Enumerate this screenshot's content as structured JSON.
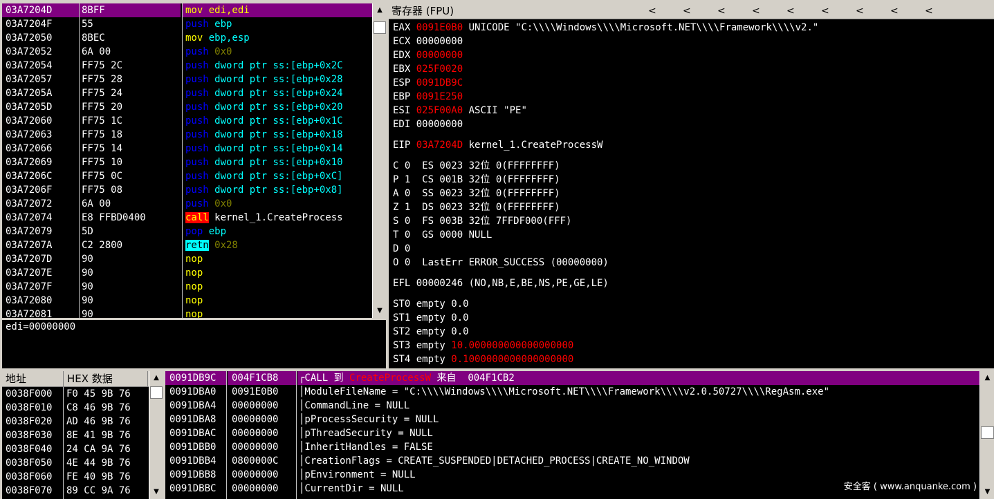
{
  "disasm": {
    "rows": [
      {
        "addr": "03A7204D",
        "hex": "8BFF",
        "parts": [
          {
            "t": "mov ",
            "c": "#ffff00"
          },
          {
            "t": "edi,edi",
            "c": "#ffff00"
          }
        ],
        "selected": true
      },
      {
        "addr": "03A7204F",
        "hex": "55",
        "parts": [
          {
            "t": "push ",
            "c": "#0000ff"
          },
          {
            "t": "ebp",
            "c": "#00ffff"
          }
        ]
      },
      {
        "addr": "03A72050",
        "hex": "8BEC",
        "parts": [
          {
            "t": "mov ",
            "c": "#ffff00"
          },
          {
            "t": "ebp,esp",
            "c": "#00ffff"
          }
        ]
      },
      {
        "addr": "03A72052",
        "hex": "6A 00",
        "parts": [
          {
            "t": "push ",
            "c": "#0000ff"
          },
          {
            "t": "0x0",
            "c": "#808000"
          }
        ]
      },
      {
        "addr": "03A72054",
        "hex": "FF75 2C",
        "parts": [
          {
            "t": "push ",
            "c": "#0000ff"
          },
          {
            "t": "dword ptr ss:[ebp+0x2C",
            "c": "#00ffff"
          }
        ]
      },
      {
        "addr": "03A72057",
        "hex": "FF75 28",
        "parts": [
          {
            "t": "push ",
            "c": "#0000ff"
          },
          {
            "t": "dword ptr ss:[ebp+0x28",
            "c": "#00ffff"
          }
        ]
      },
      {
        "addr": "03A7205A",
        "hex": "FF75 24",
        "parts": [
          {
            "t": "push ",
            "c": "#0000ff"
          },
          {
            "t": "dword ptr ss:[ebp+0x24",
            "c": "#00ffff"
          }
        ]
      },
      {
        "addr": "03A7205D",
        "hex": "FF75 20",
        "parts": [
          {
            "t": "push ",
            "c": "#0000ff"
          },
          {
            "t": "dword ptr ss:[ebp+0x20",
            "c": "#00ffff"
          }
        ]
      },
      {
        "addr": "03A72060",
        "hex": "FF75 1C",
        "parts": [
          {
            "t": "push ",
            "c": "#0000ff"
          },
          {
            "t": "dword ptr ss:[ebp+0x1C",
            "c": "#00ffff"
          }
        ]
      },
      {
        "addr": "03A72063",
        "hex": "FF75 18",
        "parts": [
          {
            "t": "push ",
            "c": "#0000ff"
          },
          {
            "t": "dword ptr ss:[ebp+0x18",
            "c": "#00ffff"
          }
        ]
      },
      {
        "addr": "03A72066",
        "hex": "FF75 14",
        "parts": [
          {
            "t": "push ",
            "c": "#0000ff"
          },
          {
            "t": "dword ptr ss:[ebp+0x14",
            "c": "#00ffff"
          }
        ]
      },
      {
        "addr": "03A72069",
        "hex": "FF75 10",
        "parts": [
          {
            "t": "push ",
            "c": "#0000ff"
          },
          {
            "t": "dword ptr ss:[ebp+0x10",
            "c": "#00ffff"
          }
        ]
      },
      {
        "addr": "03A7206C",
        "hex": "FF75 0C",
        "parts": [
          {
            "t": "push ",
            "c": "#0000ff"
          },
          {
            "t": "dword ptr ss:[ebp+0xC]",
            "c": "#00ffff"
          }
        ]
      },
      {
        "addr": "03A7206F",
        "hex": "FF75 08",
        "parts": [
          {
            "t": "push ",
            "c": "#0000ff"
          },
          {
            "t": "dword ptr ss:[ebp+0x8]",
            "c": "#00ffff"
          }
        ]
      },
      {
        "addr": "03A72072",
        "hex": "6A 00",
        "parts": [
          {
            "t": "push ",
            "c": "#0000ff"
          },
          {
            "t": "0x0",
            "c": "#808000"
          }
        ]
      },
      {
        "addr": "03A72074",
        "hex": "E8 FFBD0400",
        "parts": [
          {
            "t": "call",
            "c": "#ffff00",
            "bg": "#ff0000"
          },
          {
            "t": " kernel_1.CreateProcess",
            "c": "#ffffff"
          }
        ]
      },
      {
        "addr": "03A72079",
        "hex": "5D",
        "parts": [
          {
            "t": "pop ",
            "c": "#0000ff"
          },
          {
            "t": "ebp",
            "c": "#00ffff"
          }
        ]
      },
      {
        "addr": "03A7207A",
        "hex": "C2 2800",
        "parts": [
          {
            "t": "retn",
            "c": "#000000",
            "bg": "#00ffff"
          },
          {
            "t": " 0x28",
            "c": "#808000"
          }
        ]
      },
      {
        "addr": "03A7207D",
        "hex": "90",
        "parts": [
          {
            "t": "nop",
            "c": "#ffff00"
          }
        ]
      },
      {
        "addr": "03A7207E",
        "hex": "90",
        "parts": [
          {
            "t": "nop",
            "c": "#ffff00"
          }
        ]
      },
      {
        "addr": "03A7207F",
        "hex": "90",
        "parts": [
          {
            "t": "nop",
            "c": "#ffff00"
          }
        ]
      },
      {
        "addr": "03A72080",
        "hex": "90",
        "parts": [
          {
            "t": "nop",
            "c": "#ffff00"
          }
        ]
      },
      {
        "addr": "03A72081",
        "hex": "90",
        "parts": [
          {
            "t": "nop",
            "c": "#ffff00"
          }
        ]
      }
    ]
  },
  "info": {
    "text": "edi=00000000"
  },
  "registers": {
    "title": "寄存器 (FPU)",
    "arrows": [
      "<",
      "<",
      "<",
      "<",
      "<",
      "<",
      "<",
      "<",
      "<"
    ],
    "lines": [
      {
        "parts": [
          {
            "t": "EAX ",
            "c": "#ffffff"
          },
          {
            "t": "0091E0B0",
            "c": "#ff0000"
          },
          {
            "t": " UNICODE \"C:\\\\\\\\Windows\\\\\\\\Microsoft.NET\\\\\\\\Framework\\\\\\\\v2.\"",
            "c": "#ffffff"
          }
        ]
      },
      {
        "parts": [
          {
            "t": "ECX ",
            "c": "#ffffff"
          },
          {
            "t": "00000000",
            "c": "#ffffff"
          }
        ]
      },
      {
        "parts": [
          {
            "t": "EDX ",
            "c": "#ffffff"
          },
          {
            "t": "00000000",
            "c": "#ff0000"
          }
        ]
      },
      {
        "parts": [
          {
            "t": "EBX ",
            "c": "#ffffff"
          },
          {
            "t": "025F0020",
            "c": "#ff0000"
          }
        ]
      },
      {
        "parts": [
          {
            "t": "ESP ",
            "c": "#ffffff"
          },
          {
            "t": "0091DB9C",
            "c": "#ff0000"
          }
        ]
      },
      {
        "parts": [
          {
            "t": "EBP ",
            "c": "#ffffff"
          },
          {
            "t": "0091E250",
            "c": "#ff0000"
          }
        ]
      },
      {
        "parts": [
          {
            "t": "ESI ",
            "c": "#ffffff"
          },
          {
            "t": "025F00A0",
            "c": "#ff0000"
          },
          {
            "t": " ASCII \"PE\"",
            "c": "#ffffff"
          }
        ]
      },
      {
        "parts": [
          {
            "t": "EDI ",
            "c": "#ffffff"
          },
          {
            "t": "00000000",
            "c": "#ffffff"
          }
        ]
      },
      {
        "gap": true
      },
      {
        "parts": [
          {
            "t": "EIP ",
            "c": "#ffffff"
          },
          {
            "t": "03A7204D",
            "c": "#ff0000"
          },
          {
            "t": " kernel_1.CreateProcessW",
            "c": "#ffffff"
          }
        ]
      },
      {
        "gap": true
      },
      {
        "parts": [
          {
            "t": "C 0  ES 0023 32位 0(FFFFFFFF)",
            "c": "#ffffff"
          }
        ]
      },
      {
        "parts": [
          {
            "t": "P 1  CS 001B 32位 0(FFFFFFFF)",
            "c": "#ffffff"
          }
        ]
      },
      {
        "parts": [
          {
            "t": "A 0  SS 0023 32位 0(FFFFFFFF)",
            "c": "#ffffff"
          }
        ]
      },
      {
        "parts": [
          {
            "t": "Z 1  DS 0023 32位 0(FFFFFFFF)",
            "c": "#ffffff"
          }
        ]
      },
      {
        "parts": [
          {
            "t": "S 0  FS 003B 32位 7FFDF000(FFF)",
            "c": "#ffffff"
          }
        ]
      },
      {
        "parts": [
          {
            "t": "T 0  GS 0000 NULL",
            "c": "#ffffff"
          }
        ]
      },
      {
        "parts": [
          {
            "t": "D 0",
            "c": "#ffffff"
          }
        ]
      },
      {
        "parts": [
          {
            "t": "O 0  LastErr ERROR_SUCCESS (00000000)",
            "c": "#ffffff"
          }
        ]
      },
      {
        "gap": true
      },
      {
        "parts": [
          {
            "t": "EFL 00000246 (NO,NB,E,BE,NS,PE,GE,LE)",
            "c": "#ffffff"
          }
        ]
      },
      {
        "gap": true
      },
      {
        "parts": [
          {
            "t": "ST0 empty 0.0",
            "c": "#ffffff"
          }
        ]
      },
      {
        "parts": [
          {
            "t": "ST1 empty 0.0",
            "c": "#ffffff"
          }
        ]
      },
      {
        "parts": [
          {
            "t": "ST2 empty 0.0",
            "c": "#ffffff"
          }
        ]
      },
      {
        "parts": [
          {
            "t": "ST3 empty ",
            "c": "#ffffff"
          },
          {
            "t": "10.000000000000000000",
            "c": "#ff0000"
          }
        ]
      },
      {
        "parts": [
          {
            "t": "ST4 empty ",
            "c": "#ffffff"
          },
          {
            "t": "0.1000000000000000000",
            "c": "#ff0000"
          }
        ]
      }
    ]
  },
  "dump": {
    "headers": [
      "地址",
      "HEX 数据"
    ],
    "rows": [
      {
        "addr": "0038F000",
        "hex": "F0 45 9B 76"
      },
      {
        "addr": "0038F010",
        "hex": "C8 46 9B 76"
      },
      {
        "addr": "0038F020",
        "hex": "AD 46 9B 76"
      },
      {
        "addr": "0038F030",
        "hex": "8E 41 9B 76"
      },
      {
        "addr": "0038F040",
        "hex": "24 CA 9A 76"
      },
      {
        "addr": "0038F050",
        "hex": "4E 44 9B 76"
      },
      {
        "addr": "0038F060",
        "hex": "FE 40 9B 76"
      },
      {
        "addr": "0038F070",
        "hex": "89 CC 9A 76"
      }
    ]
  },
  "stack": {
    "rows": [
      {
        "addr": "0091DB9C",
        "val": "004F1CB8",
        "parts": [
          {
            "t": "┌CALL 到 ",
            "c": "#ffffff"
          },
          {
            "t": "CreateProcessW",
            "c": "#ff0000"
          },
          {
            "t": " 来自  004F1CB2",
            "c": "#ffffff"
          }
        ],
        "selected": true
      },
      {
        "addr": "0091DBA0",
        "val": "0091E0B0",
        "parts": [
          {
            "t": "│ModuleFileName = \"C:\\\\\\\\Windows\\\\\\\\Microsoft.NET\\\\\\\\Framework\\\\\\\\v2.0.50727\\\\\\\\RegAsm.exe\"",
            "c": "#ffffff"
          }
        ]
      },
      {
        "addr": "0091DBA4",
        "val": "00000000",
        "parts": [
          {
            "t": "│CommandLine = NULL",
            "c": "#ffffff"
          }
        ]
      },
      {
        "addr": "0091DBA8",
        "val": "00000000",
        "parts": [
          {
            "t": "│pProcessSecurity = NULL",
            "c": "#ffffff"
          }
        ]
      },
      {
        "addr": "0091DBAC",
        "val": "00000000",
        "parts": [
          {
            "t": "│pThreadSecurity = NULL",
            "c": "#ffffff"
          }
        ]
      },
      {
        "addr": "0091DBB0",
        "val": "00000000",
        "parts": [
          {
            "t": "│InheritHandles = FALSE",
            "c": "#ffffff"
          }
        ]
      },
      {
        "addr": "0091DBB4",
        "val": "0800000C",
        "parts": [
          {
            "t": "│CreationFlags = CREATE_SUSPENDED|DETACHED_PROCESS|CREATE_NO_WINDOW",
            "c": "#ffffff"
          }
        ]
      },
      {
        "addr": "0091DBB8",
        "val": "00000000",
        "parts": [
          {
            "t": "│pEnvironment = NULL",
            "c": "#ffffff"
          }
        ]
      },
      {
        "addr": "0091DBBC",
        "val": "00000000",
        "parts": [
          {
            "t": "│CurrentDir = NULL",
            "c": "#ffffff"
          }
        ]
      }
    ]
  },
  "watermark": "安全客 ( www.anquanke.com )"
}
